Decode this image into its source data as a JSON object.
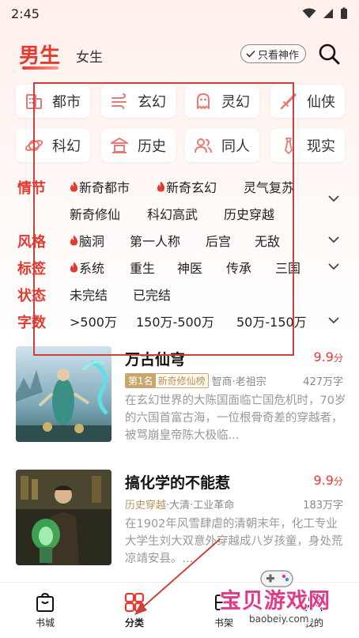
{
  "status_bar": {
    "time": "2:45"
  },
  "header": {
    "tab_male": "男生",
    "tab_female": "女生",
    "only_hits_label": "只看神作"
  },
  "categories": [
    {
      "label": "都市",
      "icon": "city-building-icon"
    },
    {
      "label": "玄幻",
      "icon": "wind-swirl-icon"
    },
    {
      "label": "灵幻",
      "icon": "ghost-icon"
    },
    {
      "label": "仙侠",
      "icon": "sword-icon"
    },
    {
      "label": "科幻",
      "icon": "planet-icon"
    },
    {
      "label": "历史",
      "icon": "pavilion-icon"
    },
    {
      "label": "同人",
      "icon": "people-icon"
    },
    {
      "label": "现实",
      "icon": "tie-icon"
    }
  ],
  "filters": {
    "plot": {
      "label": "情节",
      "row1": [
        {
          "text": "新奇都市",
          "hot": true
        },
        {
          "text": "新奇玄幻",
          "hot": true
        },
        {
          "text": "灵气复苏",
          "hot": false
        }
      ],
      "row2": [
        {
          "text": "新奇修仙",
          "hot": false
        },
        {
          "text": "科幻高武",
          "hot": false
        },
        {
          "text": "历史穿越",
          "hot": false
        }
      ]
    },
    "style": {
      "label": "风格",
      "options": [
        {
          "text": "脑洞",
          "hot": true
        },
        {
          "text": "第一人称",
          "hot": false
        },
        {
          "text": "后宫",
          "hot": false
        },
        {
          "text": "无敌",
          "hot": false
        }
      ]
    },
    "tags": {
      "label": "标签",
      "options": [
        {
          "text": "系统",
          "hot": true
        },
        {
          "text": "重生",
          "hot": false
        },
        {
          "text": "神医",
          "hot": false
        },
        {
          "text": "传承",
          "hot": false
        },
        {
          "text": "三国",
          "hot": false
        }
      ]
    },
    "status": {
      "label": "状态",
      "options": [
        {
          "text": "未完结"
        },
        {
          "text": "已完结"
        }
      ]
    },
    "words": {
      "label": "字数",
      "options": [
        {
          "text": ">500万"
        },
        {
          "text": "150万-500万"
        },
        {
          "text": "50万-150万"
        }
      ]
    }
  },
  "books": [
    {
      "title": "万古仙穹",
      "score": "9.9",
      "score_unit": "分",
      "rank_no": "第1名",
      "rank_list": "新奇修仙榜",
      "meta": "智商·老祖宗",
      "word_count": "427万字",
      "desc": "在玄幻世界的大陈国面临亡国危机时，70岁的六国首富古海，一位根骨奇差的穿越者，被骂崩皇帝陈大极临..."
    },
    {
      "title": "搞化学的不能惹",
      "score": "9.9",
      "score_unit": "分",
      "category": "历史穿越",
      "meta": "·大清·工业革命",
      "word_count": "183万字",
      "desc": "在1902年风雪肆虐的清朝末年，化工专业大学生刘大双意外穿越成八岁孩童，身处荒凉靖安县。..."
    }
  ],
  "bottom_nav": [
    {
      "label": "书城",
      "icon": "bag-icon"
    },
    {
      "label": "分类",
      "icon": "grid-category-icon"
    },
    {
      "label": "书架",
      "icon": "bookshelf-icon"
    },
    {
      "label": "我的",
      "icon": "profile-icon"
    }
  ],
  "watermark": {
    "text": "宝贝游戏网",
    "url": "baobeiy.com"
  },
  "colors": {
    "accent": "#e53a2f",
    "gold": "#c9a66b",
    "annotation": "#d0403a",
    "watermark": "#e23a8a"
  }
}
